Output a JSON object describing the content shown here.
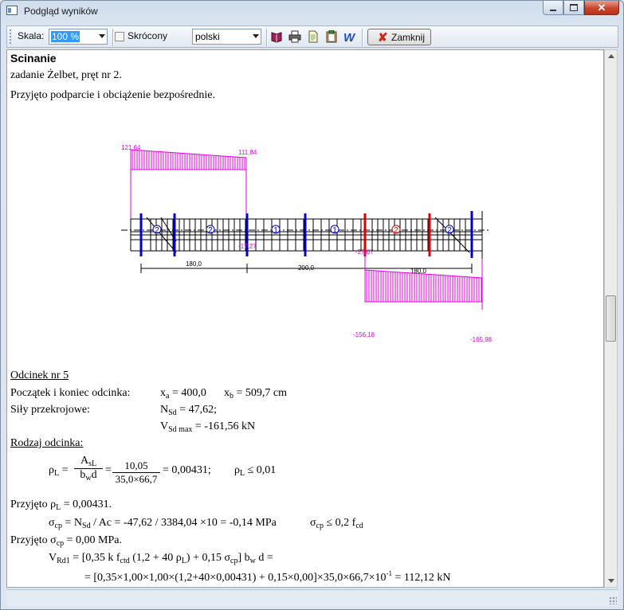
{
  "window": {
    "title": "Podgląd wyników"
  },
  "toolbar": {
    "scale_label": "Skala:",
    "scale_value": "100 %",
    "compact_label": "Skrócony",
    "compact_checked": false,
    "language_value": "polski",
    "close_label": "Zamknij"
  },
  "report": {
    "heading": "Scinanie",
    "task": "zadanie Żelbet, pręt nr 2.",
    "support_note": "Przyjęto podparcie i obciążenie bezpośrednie.",
    "diagram": {
      "top_left_value": "121,64",
      "top_right_value": "111,84",
      "mid_left_value": "-17,27",
      "mid_right_value": "-27,07",
      "bottom_left_value": "-156,18",
      "bottom_right_value": "-165,98",
      "dim_1": "180,0",
      "dim_2": "200,0",
      "dim_3": "180,0",
      "zones": [
        "2",
        "2",
        "1",
        "1",
        "2",
        "2"
      ]
    },
    "segment_title": "Odcinek nr 5",
    "segment_range_label": "Początek i koniec odcinka:",
    "xa_expr": "= 400,0",
    "xb_expr": "= 509,7 cm",
    "forces_label": "Siły przekrojowe:",
    "nsd_expr": "= 47,62;",
    "vsd_expr": "= -161,56 kN",
    "type_title": "Rodzaj odcinka:",
    "rho_numer": "10,05",
    "rho_denom": "35,0×66,7",
    "rho_result": "= 0,00431;",
    "rho_limit": "≤ 0,01",
    "rho_adopted": "= 0,00431.",
    "sigma_formula": "/ Ac = -47,62 / 3384,04 ×10 = -0,14 MPa",
    "sigma_limit": "≤ 0,2 f",
    "sigma_adopted": "= 0,00 MPa.",
    "vrd_formula_a": "= [0,35 k f",
    "vrd_formula_b": " (1,2 + 40 ρ",
    "vrd_formula_c": ") + 0,15 σ",
    "vrd_formula_d": "] b",
    "vrd_formula_e": " d =",
    "vrd_values": "= [0,35×1,00×1,00×(1,2+40×0,00431) + 0,15×0,00]×35,0×66,7×10",
    "vrd_exp": "-1",
    "vrd_result": " = 112,12 kN"
  },
  "colors": {
    "diagram_accent": "#e000e0",
    "stirrup_blue": "#0000cc",
    "stirrup_red": "#dd0000",
    "close_icon": "#d0261a"
  }
}
